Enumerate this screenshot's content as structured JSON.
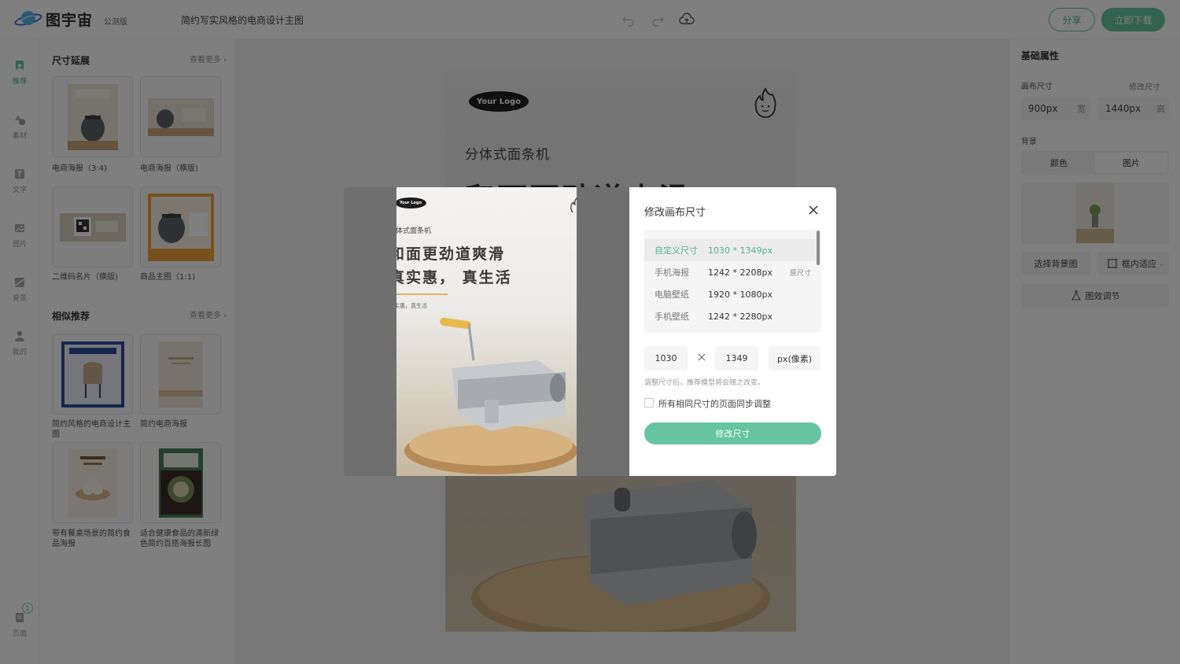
{
  "app": {
    "name": "图宇宙",
    "badge": "公测版",
    "doc_title": "简约写实风格的电商设计主图",
    "share_label": "分享",
    "download_label": "立即下载",
    "brand_color": "#66c4a2"
  },
  "leftnav": {
    "items": [
      {
        "label": "推荐",
        "icon": "recommend-icon",
        "active": true
      },
      {
        "label": "素材",
        "icon": "shapes-icon"
      },
      {
        "label": "文字",
        "icon": "text-icon"
      },
      {
        "label": "图片",
        "icon": "image-icon"
      },
      {
        "label": "背景",
        "icon": "background-icon"
      },
      {
        "label": "我的",
        "icon": "user-icon"
      }
    ],
    "pages_label": "页面",
    "pages_count": "1"
  },
  "leftpanel": {
    "sections": [
      {
        "title": "尺寸延展",
        "more": "查看更多",
        "items": [
          {
            "label": "电商海报（3:4)"
          },
          {
            "label": "电商海报（横版)"
          },
          {
            "label": "二维码名片（横版)"
          },
          {
            "label": "商品主图（1:1)"
          }
        ]
      },
      {
        "title": "相似推荐",
        "more": "查看更多",
        "items": [
          {
            "label": "简约风格的电商设计主图"
          },
          {
            "label": "简约电商海报"
          },
          {
            "label": "带有餐桌场景的简约食品海报"
          },
          {
            "label": "适合健康食品的清新绿色简约百搭海报长图"
          }
        ]
      }
    ]
  },
  "canvas": {
    "logo": "Your Logo",
    "subtitle": "分体式面条机",
    "headline": "和面更劲道爽滑"
  },
  "rightpanel": {
    "title": "基础属性",
    "canvas_size_label": "画布尺寸",
    "modify_size_label": "修改尺寸",
    "width_value": "900px",
    "width_unit": "宽",
    "height_value": "1440px",
    "height_unit": "高",
    "background_label": "背景",
    "tab_color": "颜色",
    "tab_image": "图片",
    "choose_bg": "选择背景图",
    "fit_mode": "框内适应",
    "effect_adjust": "图效调节"
  },
  "preview": {
    "logo": "Your Logo",
    "subtitle": "分体式面条机",
    "headline_1": "和面更劲道爽滑",
    "headline_2": "真实惠， 真生活",
    "small": "真实惠，真生活"
  },
  "modal": {
    "title": "修改画布尺寸",
    "sizes": [
      {
        "name": "自定义尺寸",
        "value": "1030 * 1349px",
        "tag": "",
        "selected": true
      },
      {
        "name": "手机海报",
        "value": "1242 * 2208px",
        "tag": "原尺寸"
      },
      {
        "name": "电脑壁纸",
        "value": "1920 * 1080px",
        "tag": ""
      },
      {
        "name": "手机壁纸",
        "value": "1242 * 2280px",
        "tag": ""
      }
    ],
    "width_input": "1030",
    "height_input": "1349",
    "unit": "px(像素)",
    "tip": "调整尺寸后，推荐模型将会随之改变。",
    "sync_label": "所有相同尺寸的页面同步调整",
    "sync_checked": false,
    "submit_label": "修改尺寸"
  }
}
